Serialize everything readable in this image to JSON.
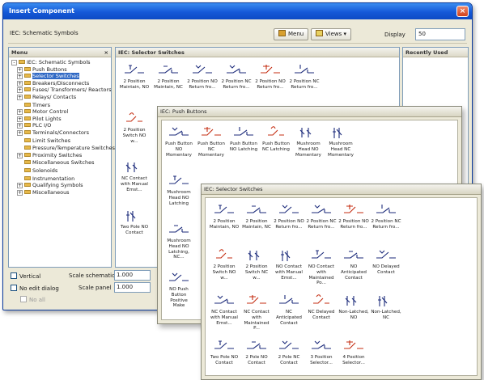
{
  "window": {
    "title": "Insert Component",
    "close": "×"
  },
  "library": {
    "name": "IEC: Schematic Symbols",
    "menu_label": "Menu",
    "views_label": "Views ▾",
    "display_label": "Display",
    "display_value": "50"
  },
  "menu_panel": {
    "title": "Menu",
    "close": "×",
    "tree": [
      {
        "label": "IEC: Schematic Symbols",
        "level": 0,
        "tog": "-",
        "selected": false
      },
      {
        "label": "Push Buttons",
        "level": 1,
        "tog": "+",
        "selected": false
      },
      {
        "label": "Selector Switches",
        "level": 1,
        "tog": "+",
        "selected": true
      },
      {
        "label": "Breakers/Disconnects",
        "level": 1,
        "tog": "+",
        "selected": false
      },
      {
        "label": "Fuses/ Transformers/ Reactors",
        "level": 1,
        "tog": "+",
        "selected": false
      },
      {
        "label": "Relays/ Contacts",
        "level": 1,
        "tog": "+",
        "selected": false
      },
      {
        "label": "Timers",
        "level": 1,
        "tog": "",
        "selected": false
      },
      {
        "label": "Motor Control",
        "level": 1,
        "tog": "+",
        "selected": false
      },
      {
        "label": "Pilot Lights",
        "level": 1,
        "tog": "+",
        "selected": false
      },
      {
        "label": "PLC I/O",
        "level": 1,
        "tog": "+",
        "selected": false
      },
      {
        "label": "Terminals/Connectors",
        "level": 1,
        "tog": "+",
        "selected": false
      },
      {
        "label": "Limit Switches",
        "level": 1,
        "tog": "",
        "selected": false
      },
      {
        "label": "Pressure/Temperature Switches",
        "level": 1,
        "tog": "",
        "selected": false
      },
      {
        "label": "Proximity Switches",
        "level": 1,
        "tog": "+",
        "selected": false
      },
      {
        "label": "Miscellaneous Switches",
        "level": 1,
        "tog": "",
        "selected": false
      },
      {
        "label": "Solenoids",
        "level": 1,
        "tog": "",
        "selected": false
      },
      {
        "label": "Instrumentation",
        "level": 1,
        "tog": "",
        "selected": false
      },
      {
        "label": "Qualifying Symbols",
        "level": 1,
        "tog": "+",
        "selected": false
      },
      {
        "label": "Miscellaneous",
        "level": 1,
        "tog": "+",
        "selected": false
      }
    ]
  },
  "main_panel": {
    "title": "IEC: Selector Switches",
    "items": [
      {
        "label": "2 Position Maintain, NO"
      },
      {
        "label": "2 Position Maintain, NC"
      },
      {
        "label": "2 Position NO Return fro..."
      },
      {
        "label": "2 Position NC Return fro..."
      },
      {
        "label": "2 Position NO Return fro..."
      },
      {
        "label": "2 Position NC Return fro..."
      },
      {
        "label": "2 Position Switch NO w..."
      },
      {
        "label": "NC Contact with Manual Emst..."
      },
      {
        "label": "Two Pole NO Contact"
      }
    ]
  },
  "recently_used": {
    "title": "Recently Used"
  },
  "bottom": {
    "vertical": "Vertical",
    "no_edit": "No edit dialog",
    "no_all": "No all",
    "scale_schematic_label": "Scale schematic",
    "scale_schematic_value": "1.000",
    "scale_panel_label": "Scale panel",
    "scale_panel_value": "1.000"
  },
  "push_buttons": {
    "title": "IEC: Push Buttons",
    "items": [
      {
        "label": "Push Button NO Momentary"
      },
      {
        "label": "Push Button NC Momentary"
      },
      {
        "label": "Push Button NO Latching"
      },
      {
        "label": "Push Button NC Latching"
      },
      {
        "label": "Mushroom Head NO Momentary"
      },
      {
        "label": "Mushroom Head NC Momentary"
      },
      {
        "label": "Mushroom Head NO Latching"
      },
      {
        "label": "Mushroom Head NO Latching, NC..."
      },
      {
        "label": "NO Push Button Positive Make"
      }
    ]
  },
  "selector_float": {
    "title": "IEC: Selector Switches",
    "items": [
      {
        "label": "2 Position Maintain, NO"
      },
      {
        "label": "2 Position Maintain, NC"
      },
      {
        "label": "2 Position NO Return fro..."
      },
      {
        "label": "2 Position NC Return fro..."
      },
      {
        "label": "2 Position NO Return fro..."
      },
      {
        "label": "2 Position NC Return fro..."
      },
      {
        "label": "2 Position Switch NO w..."
      },
      {
        "label": "2 Position Switch NC w..."
      },
      {
        "label": "NO Contact with Manual Emst..."
      },
      {
        "label": "NO Contact with Maintained Po..."
      },
      {
        "label": "NO Anticipated Contact"
      },
      {
        "label": "NO Delayed Contact"
      },
      {
        "label": "NC Contact with Manual Emst..."
      },
      {
        "label": "NC Contact with Maintained P..."
      },
      {
        "label": "NC Anticipated Contact"
      },
      {
        "label": "NC Delayed Contact"
      },
      {
        "label": "Non-Latched, NO"
      },
      {
        "label": "Non-Latched, NC"
      },
      {
        "label": "Two Pole NO Contact"
      },
      {
        "label": "2 Pole NO Contact"
      },
      {
        "label": "2 Pole NC Contact"
      },
      {
        "label": "3 Position Selector..."
      },
      {
        "label": "4 Position Selector..."
      }
    ]
  }
}
